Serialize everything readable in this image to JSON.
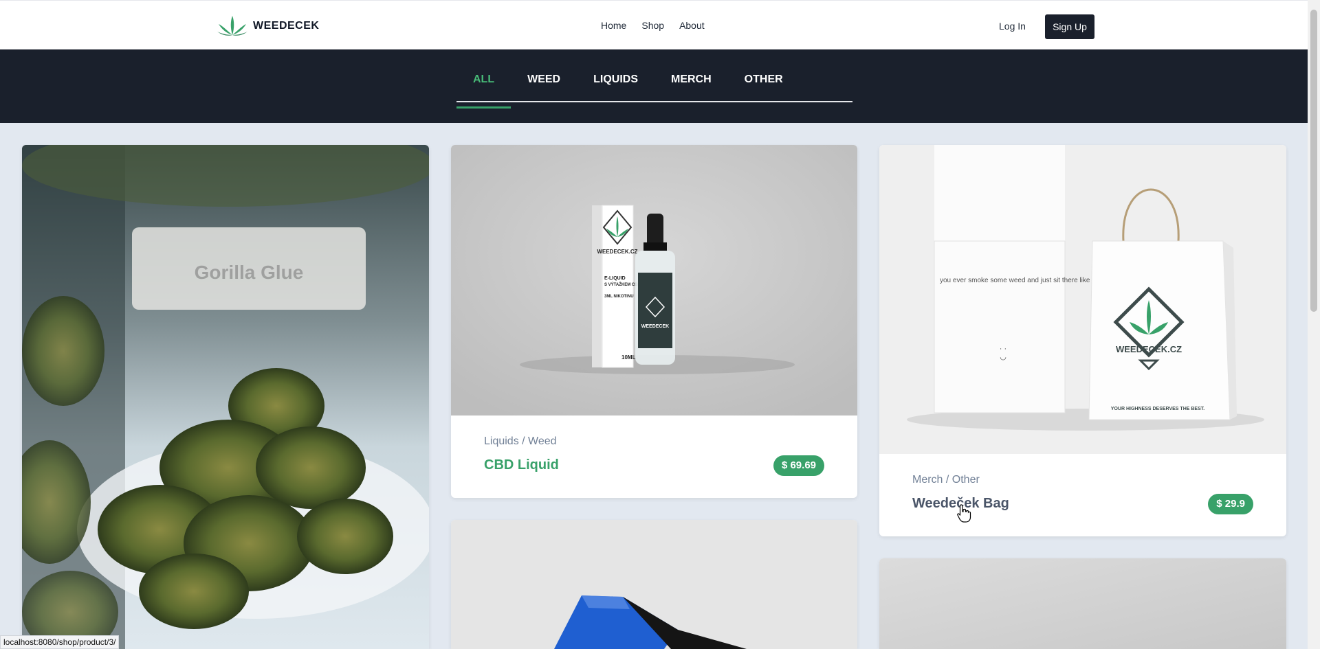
{
  "nav": {
    "brand": "WEEDECEK",
    "links": [
      "Home",
      "Shop",
      "About"
    ],
    "login": "Log In",
    "signup": "Sign Up"
  },
  "categories": {
    "tabs": [
      "ALL",
      "WEED",
      "LIQUIDS",
      "MERCH",
      "OTHER"
    ],
    "active": "ALL"
  },
  "products": [
    {
      "category": "Liquids / Weed",
      "name": "CBD Liquid",
      "price": "$ 69.69"
    },
    {
      "category": "Merch / Other",
      "name": "Weedeček Bag",
      "price": "$ 29.9"
    }
  ],
  "images": {
    "liquid_box_brand": "WEEDECEK.CZ",
    "liquid_box_line1": "E-LIQUID",
    "liquid_box_line2": "S VÝTAŽKEM CBD",
    "liquid_box_line3": "3ML NIKOTINU",
    "liquid_box_volume": "10ML",
    "bottle_label": "WEEDECEK",
    "bag_text": "you ever smoke some weed and just sit there like",
    "bag_brand": "WEEDECEK.CZ",
    "bag_slogan": "YOUR HIGHNESS DESERVES THE BEST.",
    "jar_label": "Gorilla Glue"
  },
  "status_url": "localhost:8080/shop/product/3/",
  "colors": {
    "accent": "#38a169",
    "dark": "#1a202c",
    "page_bg": "#e2e8f0"
  }
}
